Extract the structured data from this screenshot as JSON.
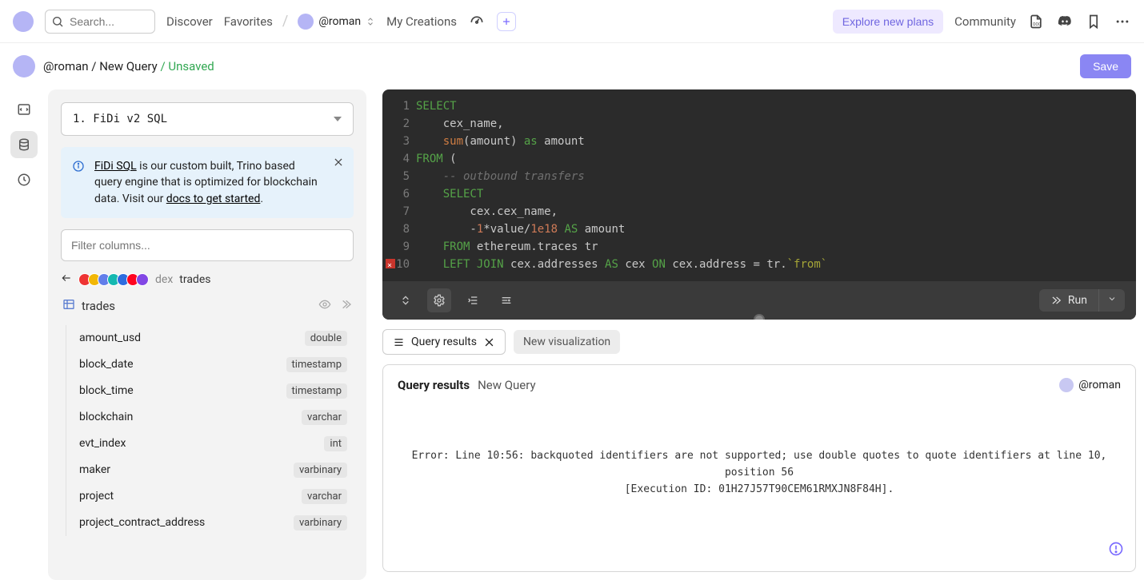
{
  "topbar": {
    "search_placeholder": "Search...",
    "discover": "Discover",
    "favorites": "Favorites",
    "user_handle": "@roman",
    "my_creations": "My Creations",
    "explore_plans": "Explore new plans",
    "community": "Community"
  },
  "breadcrumb": {
    "handle": "@roman",
    "sep": " / ",
    "query": "New Query",
    "unsaved": "/ Unsaved",
    "save": "Save"
  },
  "explorer": {
    "engine_label": "1. FiDi v2 SQL",
    "info": {
      "link1": "FiDi SQL",
      "text1": " is our custom built, Trino based query engine that is optimized for blockchain data. Visit our ",
      "link2": "docs to get started",
      "text2": "."
    },
    "filter_placeholder": "Filter columns...",
    "crumb": {
      "group": "dex",
      "table": "trades"
    },
    "table_name": "trades",
    "columns": [
      {
        "name": "amount_usd",
        "type": "double"
      },
      {
        "name": "block_date",
        "type": "timestamp"
      },
      {
        "name": "block_time",
        "type": "timestamp"
      },
      {
        "name": "blockchain",
        "type": "varchar"
      },
      {
        "name": "evt_index",
        "type": "int"
      },
      {
        "name": "maker",
        "type": "varbinary"
      },
      {
        "name": "project",
        "type": "varchar"
      },
      {
        "name": "project_contract_address",
        "type": "varbinary"
      }
    ]
  },
  "editor": {
    "lines": [
      "1",
      "2",
      "3",
      "4",
      "5",
      "6",
      "7",
      "8",
      "9",
      "10"
    ],
    "code": {
      "l1a": "SELECT",
      "l2": "    cex_name,",
      "l3a": "    ",
      "l3fn": "sum",
      "l3b": "(amount) ",
      "l3kw": "as",
      "l3c": " amount",
      "l4a": "FROM",
      "l4b": " (",
      "l5": "    -- outbound transfers",
      "l6": "    SELECT",
      "l7": "        cex.cex_name,",
      "l8a": "        -",
      "l8n1": "1",
      "l8b": "*value/",
      "l8n2": "1e18",
      "l8c": " ",
      "l8kw": "AS",
      "l8d": " amount",
      "l9a": "    FROM",
      "l9b": " ethereum.traces tr",
      "l10a": "    LEFT",
      "l10b": " ",
      "l10c": "JOIN",
      "l10d": " cex.addresses ",
      "l10e": "AS",
      "l10f": " cex ",
      "l10g": "ON",
      "l10h": " cex.address = tr.",
      "l10s": "`from`"
    },
    "run": "Run"
  },
  "tabs": {
    "results": "Query results",
    "newviz": "New visualization"
  },
  "results": {
    "title": "Query results",
    "subtitle": "New Query",
    "owner": "@roman",
    "error_line1": "Error: Line 10:56: backquoted identifiers are not supported; use double quotes to quote identifiers at line 10, position 56",
    "error_line2": "[Execution ID: 01H27J57T90CEM61RMXJN8F84H]."
  }
}
